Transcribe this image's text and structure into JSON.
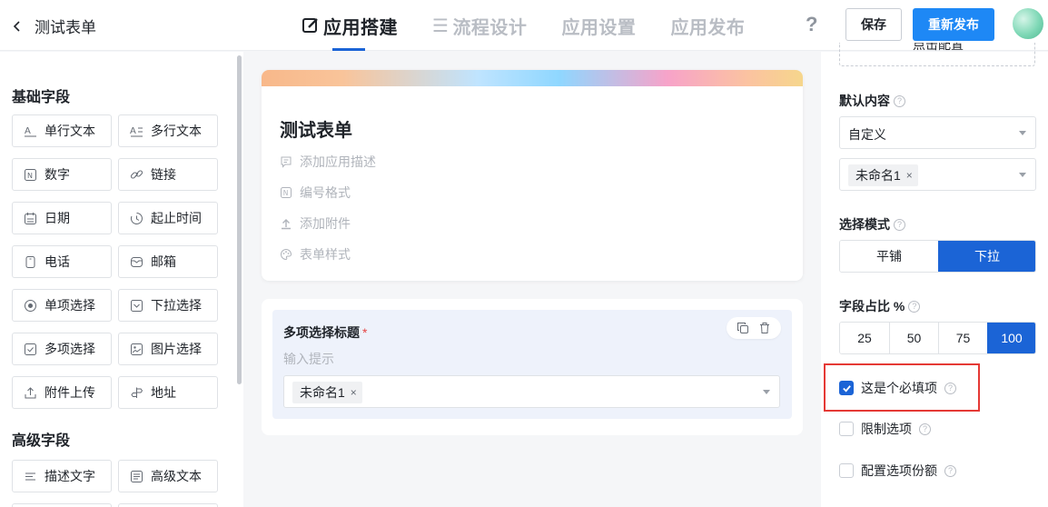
{
  "header": {
    "back_title": "测试表单",
    "tabs": [
      {
        "label": "应用搭建",
        "active": true
      },
      {
        "label": "流程设计",
        "active": false
      },
      {
        "label": "应用设置",
        "active": false
      },
      {
        "label": "应用发布",
        "active": false
      }
    ],
    "help": "?",
    "save_label": "保存",
    "publish_label": "重新发布"
  },
  "sidebar": {
    "basic_title": "基础字段",
    "basic_fields": [
      {
        "label": "单行文本",
        "icon": "single-line-text-icon"
      },
      {
        "label": "多行文本",
        "icon": "multi-line-text-icon"
      },
      {
        "label": "数字",
        "icon": "number-icon"
      },
      {
        "label": "链接",
        "icon": "link-icon"
      },
      {
        "label": "日期",
        "icon": "calendar-icon"
      },
      {
        "label": "起止时间",
        "icon": "time-range-icon"
      },
      {
        "label": "电话",
        "icon": "phone-icon"
      },
      {
        "label": "邮箱",
        "icon": "mail-icon"
      },
      {
        "label": "单项选择",
        "icon": "radio-icon"
      },
      {
        "label": "下拉选择",
        "icon": "dropdown-icon"
      },
      {
        "label": "多项选择",
        "icon": "checkbox-icon"
      },
      {
        "label": "图片选择",
        "icon": "image-icon"
      },
      {
        "label": "附件上传",
        "icon": "upload-icon"
      },
      {
        "label": "地址",
        "icon": "location-icon"
      }
    ],
    "advanced_title": "高级字段",
    "advanced_fields": [
      {
        "label": "描述文字",
        "icon": "description-icon"
      },
      {
        "label": "高级文本",
        "icon": "rich-text-icon"
      }
    ]
  },
  "form": {
    "title": "测试表单",
    "meta": [
      {
        "label": "添加应用描述",
        "icon": "comment-icon"
      },
      {
        "label": "编号格式",
        "icon": "number-format-icon"
      },
      {
        "label": "添加附件",
        "icon": "upload-icon"
      },
      {
        "label": "表单样式",
        "icon": "palette-icon"
      }
    ],
    "field": {
      "label": "多项选择标题",
      "required_mark": "*",
      "hint": "输入提示",
      "chip": "未命名1",
      "chip_close": "×"
    }
  },
  "panel": {
    "top_text": "点击配置",
    "default_label": "默认内容",
    "default_select": "自定义",
    "default_chip": "未命名1",
    "chip_close": "×",
    "mode_label": "选择模式",
    "mode_options": [
      {
        "label": "平铺",
        "on": false
      },
      {
        "label": "下拉",
        "on": true
      }
    ],
    "ratio_label": "字段占比 %",
    "ratio_options": [
      {
        "label": "25",
        "on": false
      },
      {
        "label": "50",
        "on": false
      },
      {
        "label": "75",
        "on": false
      },
      {
        "label": "100",
        "on": true
      }
    ],
    "checks": [
      {
        "label": "这是个必填项",
        "checked": true
      },
      {
        "label": "限制选项",
        "checked": false
      },
      {
        "label": "配置选项份额",
        "checked": false
      }
    ],
    "help_glyph": "?"
  },
  "colors": {
    "primary": "#1b64d6",
    "publish": "#1e88f5",
    "highlight": "#e53935"
  }
}
